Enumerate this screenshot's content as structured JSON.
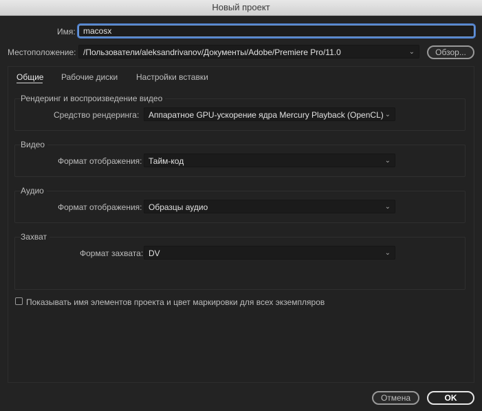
{
  "window": {
    "title": "Новый проект"
  },
  "name_field": {
    "label": "Имя:",
    "value": "macosx"
  },
  "location": {
    "label": "Местоположение:",
    "value": "/Пользователи/aleksandrivanov/Документы/Adobe/Premiere Pro/11.0",
    "browse_label": "Обзор..."
  },
  "tabs": [
    {
      "label": "Общие",
      "active": true
    },
    {
      "label": "Рабочие диски",
      "active": false
    },
    {
      "label": "Настройки вставки",
      "active": false
    }
  ],
  "render_group": {
    "title": "Рендеринг и воспроизведение видео",
    "renderer_label": "Средство рендеринга:",
    "renderer_value": "Аппаратное GPU-ускорение ядра Mercury Playback (OpenCL)"
  },
  "video_group": {
    "title": "Видео",
    "format_label": "Формат отображения:",
    "format_value": "Тайм-код"
  },
  "audio_group": {
    "title": "Аудио",
    "format_label": "Формат отображения:",
    "format_value": "Образцы аудио"
  },
  "capture_group": {
    "title": "Захват",
    "format_label": "Формат захвата:",
    "format_value": "DV"
  },
  "show_names_checkbox": {
    "label": "Показывать имя элементов проекта и цвет маркировки для всех экземпляров",
    "checked": false
  },
  "buttons": {
    "cancel": "Отмена",
    "ok": "OK"
  },
  "icons": {
    "dropdown": "chevron-down-icon"
  },
  "colors": {
    "background": "#232323",
    "focus": "#4f7fc9"
  }
}
